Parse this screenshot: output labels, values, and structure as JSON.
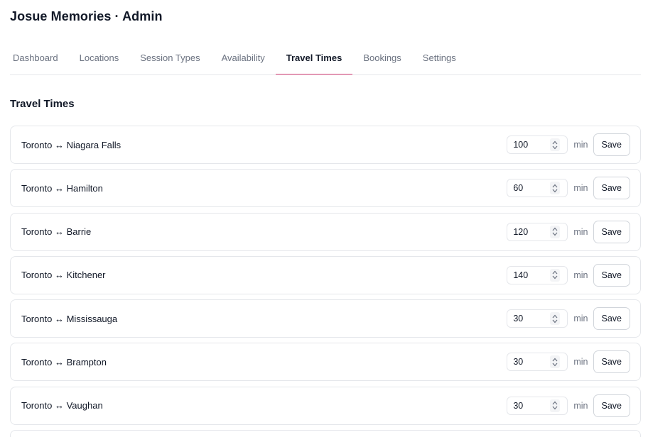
{
  "app": {
    "title": "Josue Memories · Admin"
  },
  "tabs": [
    {
      "label": "Dashboard",
      "active": false
    },
    {
      "label": "Locations",
      "active": false
    },
    {
      "label": "Session Types",
      "active": false
    },
    {
      "label": "Availability",
      "active": false
    },
    {
      "label": "Travel Times",
      "active": true
    },
    {
      "label": "Bookings",
      "active": false
    },
    {
      "label": "Settings",
      "active": false
    }
  ],
  "section": {
    "title": "Travel Times"
  },
  "travel_times": [
    {
      "route": "Toronto ↔ Niagara Falls",
      "minutes": "100",
      "unit": "min",
      "save_label": "Save"
    },
    {
      "route": "Toronto ↔ Hamilton",
      "minutes": "60",
      "unit": "min",
      "save_label": "Save"
    },
    {
      "route": "Toronto ↔ Barrie",
      "minutes": "120",
      "unit": "min",
      "save_label": "Save"
    },
    {
      "route": "Toronto ↔ Kitchener",
      "minutes": "140",
      "unit": "min",
      "save_label": "Save"
    },
    {
      "route": "Toronto ↔ Mississauga",
      "minutes": "30",
      "unit": "min",
      "save_label": "Save"
    },
    {
      "route": "Toronto ↔ Brampton",
      "minutes": "30",
      "unit": "min",
      "save_label": "Save"
    },
    {
      "route": "Toronto ↔ Vaughan",
      "minutes": "30",
      "unit": "min",
      "save_label": "Save"
    }
  ],
  "colors": {
    "active_tab_underline": "#e0457b",
    "border": "#e5e7eb",
    "text": "#111827",
    "muted_text": "#6b7280"
  }
}
